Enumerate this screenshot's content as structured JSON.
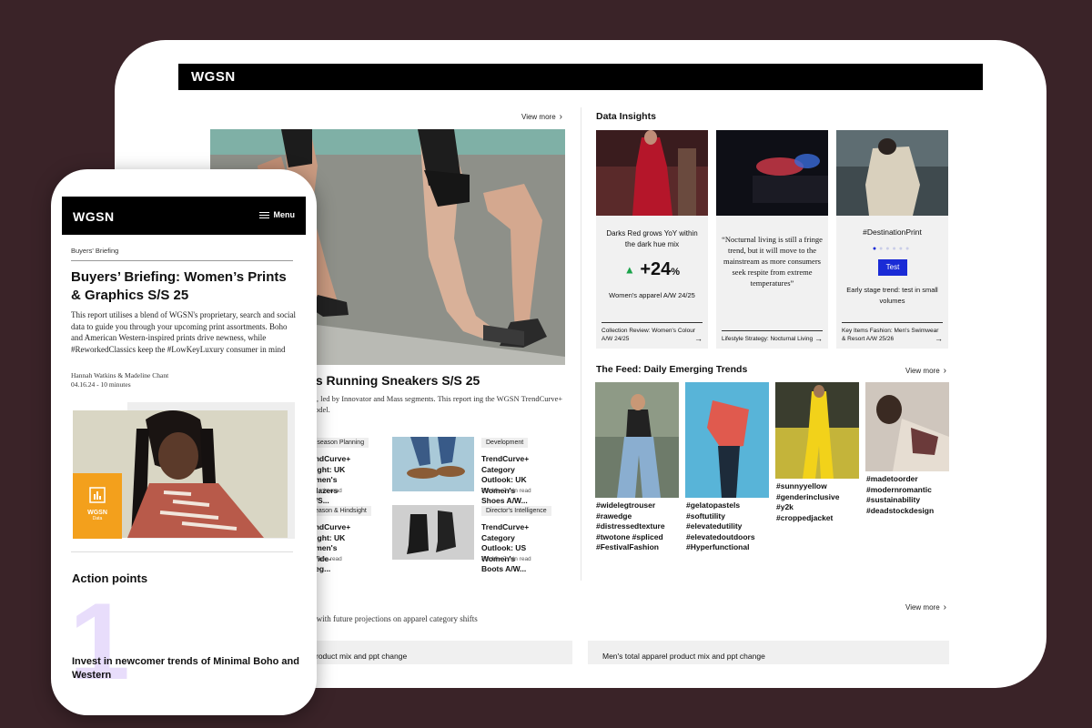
{
  "tablet": {
    "logo": "WGSN",
    "view_more": "View more",
    "hero": {
      "title": "light: UK Women's Running Sneakers S/S 25",
      "desc": "s a recent uptick in the UK market, led by Innovator and Mass segments. This report ing the WGSN TrendCurve+ predictive analytics forecasting model."
    },
    "small_cards": [
      {
        "tag": "-season Planning",
        "title": "endCurve+\ntlight: UK\nomen's Blazers S/S...",
        "meta": "• 7 min read"
      },
      {
        "tag": "Development",
        "title": "TrendCurve+\nCategory Outlook: UK\nWomen's Shoes A/W...",
        "meta": "8.8.19  •  7 min read"
      },
      {
        "tag": "eason & Hindsight",
        "title": "endCurve+\ntlight: UK\nomen's Wide-Leg...",
        "meta": "• 7 min read"
      },
      {
        "tag": "Director's Intelligence",
        "title": "TrendCurve+\nCategory Outlook: US\nWomen's Boots A/W...",
        "meta": "8.8.19  •  7 min read"
      }
    ],
    "data_insights": {
      "heading": "Data Insights",
      "cards": [
        {
          "text": "Darks Red grows YoY within the dark hue mix",
          "stat": "+24",
          "stat_unit": "%",
          "sub": "Women's apparel A/W 24/25",
          "foot": "Collection Review: Women's Colour A/W 24/25"
        },
        {
          "text": "“Nocturnal living is still a fringe trend, but it will move to the mainstream as more consumers seek respite from extreme temperatures”",
          "foot": "Lifestyle Strategy: Nocturnal Living"
        },
        {
          "text": "#DestinationPrint",
          "button": "Test",
          "sub": "Early stage trend: test in small volumes",
          "foot": "Key Items Fashion: Men's Swimwear & Resort A/W 25/26"
        }
      ]
    },
    "feed": {
      "heading": "The Feed: Daily Emerging Trends",
      "items": [
        {
          "tags": "#widelegtrouser\n#rawedge\n#distressedtexture\n#twotone #spliced\n#FestivalFashion"
        },
        {
          "tags": "#gelatopastels\n#softutility\n#elevatedutility\n#elevatedoutdoors\n#Hyperfunctional"
        },
        {
          "tags": "#sunnyyellow\n#genderinclusive\n#y2k\n#croppedjacket"
        },
        {
          "tags": "#madetoorder\n#modernromantic\n#sustainability\n#deadstockdesign"
        }
      ]
    },
    "bottom": {
      "desc": "g with future projections on apparel category shifts",
      "panel_left": "roduct mix and ppt change",
      "panel_right": "Men's total apparel product mix and ppt change"
    }
  },
  "phone": {
    "logo": "WGSN",
    "menu": "Menu",
    "breadcrumb": "Buyers' Briefing",
    "title": "Buyers’ Briefing: Women’s Prints & Graphics S/S 25",
    "body": "This report utilises a blend of WGSN's proprietary, search and social data to guide you through your upcoming print assortments. Boho and American Western-inspired prints drive newness, while #ReworkedClassics keep the #LowKeyLuxury consumer in mind",
    "authors": "Hannah Watkins & Madeline Chant",
    "date": "04.16.24 - 10 minutes",
    "badge": "WGSN",
    "badge_sub": "Data",
    "action_heading": "Action points",
    "action_number": "1",
    "action_text": "Invest in newcomer trends of Minimal Boho and Western"
  },
  "colors": {
    "background": "#3a2328",
    "accent_blue": "#1a2bd6",
    "badge_orange": "#f3a01c",
    "up_green": "#1aa34a"
  }
}
